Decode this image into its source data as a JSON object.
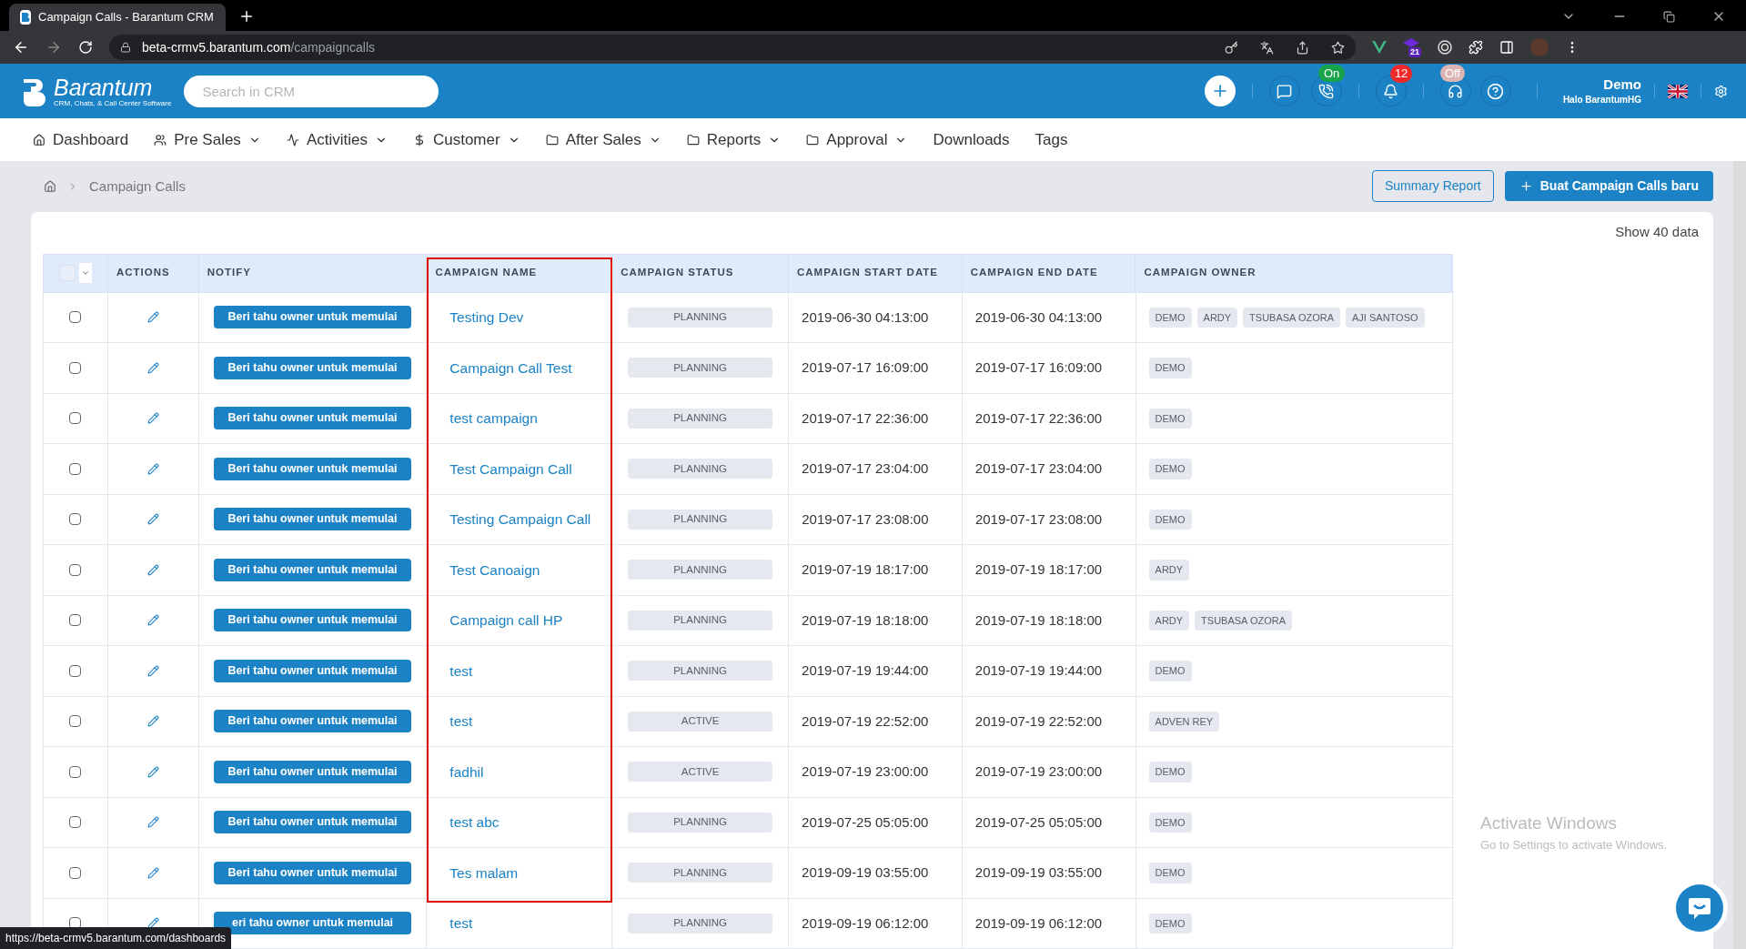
{
  "browser": {
    "tab_title": "Campaign Calls - Barantum CRM",
    "url_host": "beta-crmv5.barantum.com",
    "url_path": "/campaigncalls",
    "extension_badge": "21",
    "status_link": "https://beta-crmv5.barantum.com/dashboards"
  },
  "header": {
    "logo": "Barantum",
    "logo_tagline": "CRM, Chats, & Call Center Software",
    "search": {
      "placeholder": "Search in CRM"
    },
    "phone_badge": "On",
    "notification_count": "12",
    "headset_badge": "Off",
    "user_name": "Demo",
    "user_greeting": "Halo BarantumHG"
  },
  "nav": [
    {
      "label": "Dashboard",
      "dropdown": false
    },
    {
      "label": "Pre Sales",
      "dropdown": true
    },
    {
      "label": "Activities",
      "dropdown": true
    },
    {
      "label": "Customer",
      "dropdown": true
    },
    {
      "label": "After Sales",
      "dropdown": true
    },
    {
      "label": "Reports",
      "dropdown": true
    },
    {
      "label": "Approval",
      "dropdown": true
    },
    {
      "label": "Downloads",
      "dropdown": false
    },
    {
      "label": "Tags",
      "dropdown": false
    }
  ],
  "breadcrumb": [
    "Campaign Calls"
  ],
  "buttons": {
    "summary": "Summary Report",
    "create": "Buat Campaign Calls baru"
  },
  "show_count": "Show 40 data",
  "table": {
    "select_all_checked": false,
    "columns": [
      {
        "label": "ACTIONS",
        "highlighted": false
      },
      {
        "label": "NOTIFY",
        "highlighted": false
      },
      {
        "label": "CAMPAIGN NAME",
        "highlighted": true
      },
      {
        "label": "CAMPAIGN STATUS",
        "highlighted": false
      },
      {
        "label": "CAMPAIGN START DATE",
        "highlighted": false
      },
      {
        "label": "CAMPAIGN END DATE",
        "highlighted": false
      },
      {
        "label": "CAMPAIGN OWNER",
        "highlighted": false
      }
    ],
    "rows": [
      {
        "checked": false,
        "notify": "Beri tahu owner untuk memulai",
        "name": "Testing Dev",
        "status": "PLANNING",
        "start": "2019-06-30 04:13:00",
        "end": "2019-06-30 04:13:00",
        "owners": [
          "DEMO",
          "ARDY",
          "TSUBASA OZORA",
          "AJI SANTOSO"
        ]
      },
      {
        "checked": false,
        "notify": "Beri tahu owner untuk memulai",
        "name": "Campaign Call Test",
        "status": "PLANNING",
        "start": "2019-07-17 16:09:00",
        "end": "2019-07-17 16:09:00",
        "owners": [
          "DEMO"
        ]
      },
      {
        "checked": false,
        "notify": "Beri tahu owner untuk memulai",
        "name": "test campaign",
        "status": "PLANNING",
        "start": "2019-07-17 22:36:00",
        "end": "2019-07-17 22:36:00",
        "owners": [
          "DEMO"
        ]
      },
      {
        "checked": false,
        "notify": "Beri tahu owner untuk memulai",
        "name": "Test Campaign Call",
        "status": "PLANNING",
        "start": "2019-07-17 23:04:00",
        "end": "2019-07-17 23:04:00",
        "owners": [
          "DEMO"
        ]
      },
      {
        "checked": false,
        "notify": "Beri tahu owner untuk memulai",
        "name": "Testing Campaign Call",
        "status": "PLANNING",
        "start": "2019-07-17 23:08:00",
        "end": "2019-07-17 23:08:00",
        "owners": [
          "DEMO"
        ]
      },
      {
        "checked": false,
        "notify": "Beri tahu owner untuk memulai",
        "name": "Test Canoaign",
        "status": "PLANNING",
        "start": "2019-07-19 18:17:00",
        "end": "2019-07-19 18:17:00",
        "owners": [
          "ARDY"
        ]
      },
      {
        "checked": false,
        "notify": "Beri tahu owner untuk memulai",
        "name": "Campaign call HP",
        "status": "PLANNING",
        "start": "2019-07-19 18:18:00",
        "end": "2019-07-19 18:18:00",
        "owners": [
          "ARDY",
          "TSUBASA OZORA"
        ]
      },
      {
        "checked": false,
        "notify": "Beri tahu owner untuk memulai",
        "name": "test",
        "status": "PLANNING",
        "start": "2019-07-19 19:44:00",
        "end": "2019-07-19 19:44:00",
        "owners": [
          "DEMO"
        ]
      },
      {
        "checked": false,
        "notify": "Beri tahu owner untuk memulai",
        "name": "test",
        "status": "ACTIVE",
        "start": "2019-07-19 22:52:00",
        "end": "2019-07-19 22:52:00",
        "owners": [
          "ADVEN REY"
        ]
      },
      {
        "checked": false,
        "notify": "Beri tahu owner untuk memulai",
        "name": "fadhil",
        "status": "ACTIVE",
        "start": "2019-07-19 23:00:00",
        "end": "2019-07-19 23:00:00",
        "owners": [
          "DEMO"
        ]
      },
      {
        "checked": false,
        "notify": "Beri tahu owner untuk memulai",
        "name": "test abc",
        "status": "PLANNING",
        "start": "2019-07-25 05:05:00",
        "end": "2019-07-25 05:05:00",
        "owners": [
          "DEMO"
        ]
      },
      {
        "checked": false,
        "notify": "Beri tahu owner untuk memulai",
        "name": "Tes malam",
        "status": "PLANNING",
        "start": "2019-09-19 03:55:00",
        "end": "2019-09-19 03:55:00",
        "owners": [
          "DEMO"
        ]
      },
      {
        "checked": false,
        "notify": "eri tahu owner untuk memulai",
        "name": "test",
        "status": "PLANNING",
        "start": "2019-09-19 06:12:00",
        "end": "2019-09-19 06:12:00",
        "owners": [
          "DEMO"
        ]
      }
    ]
  },
  "os_notice": {
    "title": "Activate Windows",
    "text": "Go to Settings to activate Windows."
  }
}
